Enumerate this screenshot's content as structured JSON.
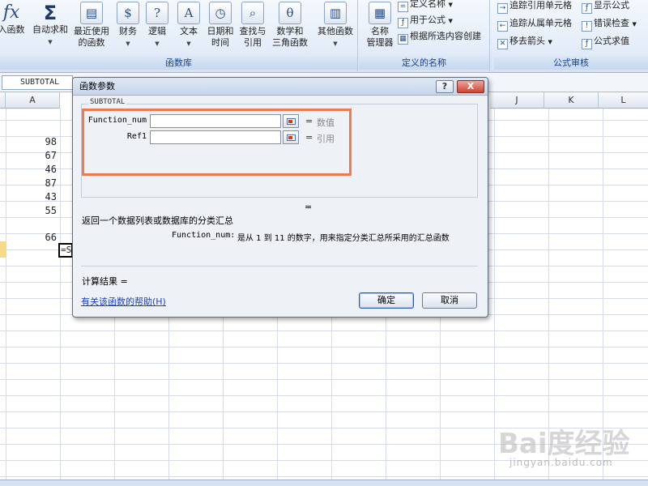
{
  "ribbon": {
    "insert_function": {
      "icon": "fx-icon",
      "label": "入函数"
    },
    "autosum": {
      "icon": "sigma-icon",
      "label": "自动求和"
    },
    "buttons": [
      {
        "label1": "最近使用",
        "label2": "的函数",
        "icon": "book-icon"
      },
      {
        "label1": "财务",
        "label2": "",
        "icon": "book-icon"
      },
      {
        "label1": "逻辑",
        "label2": "",
        "icon": "book-icon"
      },
      {
        "label1": "文本",
        "label2": "",
        "icon": "book-icon"
      },
      {
        "label1": "日期和",
        "label2": "时间",
        "icon": "book-icon"
      },
      {
        "label1": "查找与",
        "label2": "引用",
        "icon": "book-icon"
      },
      {
        "label1": "数学和",
        "label2": "三角函数",
        "icon": "book-icon"
      },
      {
        "label1": "其他函数",
        "label2": "",
        "icon": "book-icon"
      }
    ],
    "group_function_library": "函数库",
    "name_manager": {
      "label1": "名称",
      "label2": "管理器"
    },
    "define_name": "定义名称",
    "use_in_formula": "用于公式",
    "create_from_selection": "根据所选内容创建",
    "group_defined_names": "定义的名称",
    "trace_precedents": "追踪引用单元格",
    "trace_dependents": "追踪从属单元格",
    "remove_arrows": "移去箭头",
    "show_formulas": "显示公式",
    "error_checking": "错误检查",
    "evaluate_formula": "公式求值",
    "group_formula_auditing": "公式审核"
  },
  "namebox": "SUBTOTAL",
  "columns": [
    "A",
    "J",
    "K",
    "L"
  ],
  "cells": [
    "98",
    "67",
    "46",
    "87",
    "43",
    "55",
    "66"
  ],
  "active_cell_text": "=S",
  "dialog": {
    "title": "函数参数",
    "help_button": "?",
    "close_button": "X",
    "function_name": "SUBTOTAL",
    "args": [
      {
        "label": "Function_num",
        "hint": "数值"
      },
      {
        "label": "Ref1",
        "hint": "引用"
      }
    ],
    "result_equals": "=",
    "description": "返回一个数据列表或数据库的分类汇总",
    "arg_help_name": "Function_num:",
    "arg_help_text": "是从 1 到 11 的数字，用来指定分类汇总所采用的汇总函数",
    "calc_result": "计算结果 =",
    "help_link": "有关该函数的帮助(H)",
    "ok": "确定",
    "cancel": "取消"
  },
  "watermark": {
    "brand": "Bai度经验",
    "site": "jingyan.baidu.com"
  },
  "colors": {
    "highlight": "#f07a4e",
    "link": "#1a3fc9"
  }
}
